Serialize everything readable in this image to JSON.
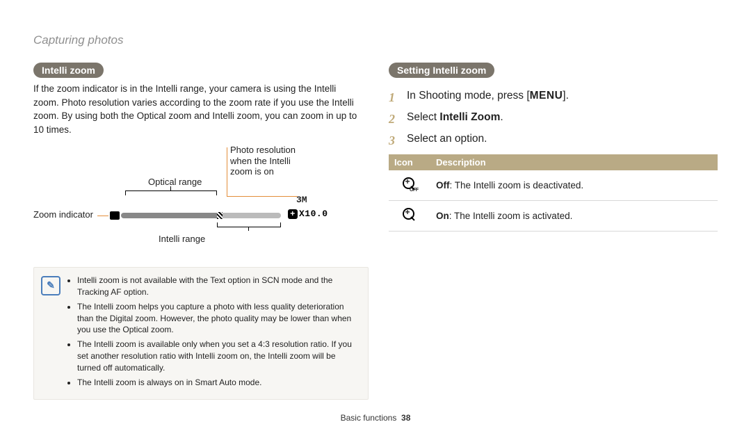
{
  "breadcrumb": "Capturing photos",
  "left": {
    "heading": "Intelli zoom",
    "paragraph": "If the zoom indicator is in the Intelli range, your camera is using the Intelli zoom. Photo resolution varies according to the zoom rate if you use the Intelli zoom. By using both the Optical zoom and Intelli zoom, you can zoom in up to 10 times.",
    "diagram": {
      "photo_res_label": "Photo resolution\nwhen the Intelli\nzoom is on",
      "optical_range_label": "Optical range",
      "zoom_indicator_label": "Zoom indicator",
      "intelli_range_label": "Intelli range",
      "three_m": "3M",
      "readout": "X10.0"
    },
    "note_items": [
      "Intelli zoom is not available with the Text option in SCN mode and the Tracking AF option.",
      "The Intelli zoom helps you capture a photo with less quality deterioration than the Digital zoom. However, the photo quality may be lower than when you use the Optical zoom.",
      "The Intelli zoom is available only when you set a 4:3 resolution ratio. If you set another resolution ratio with Intelli zoom on, the Intelli zoom will be turned off automatically.",
      "The Intelli zoom is always on in Smart Auto mode."
    ]
  },
  "right": {
    "heading": "Setting Intelli zoom",
    "steps": {
      "s1_pre": "In Shooting mode, press [",
      "s1_menu": "MENU",
      "s1_post": "].",
      "s2_pre": "Select ",
      "s2_bold": "Intelli Zoom",
      "s2_post": ".",
      "s3": "Select an option."
    },
    "table": {
      "hdr_icon": "Icon",
      "hdr_desc": "Description",
      "row1_bold": "Off",
      "row1_rest": ": The Intelli zoom is deactivated.",
      "row2_bold": "On",
      "row2_rest": ": The Intelli zoom is activated."
    }
  },
  "footer": {
    "section": "Basic functions",
    "page": "38"
  }
}
